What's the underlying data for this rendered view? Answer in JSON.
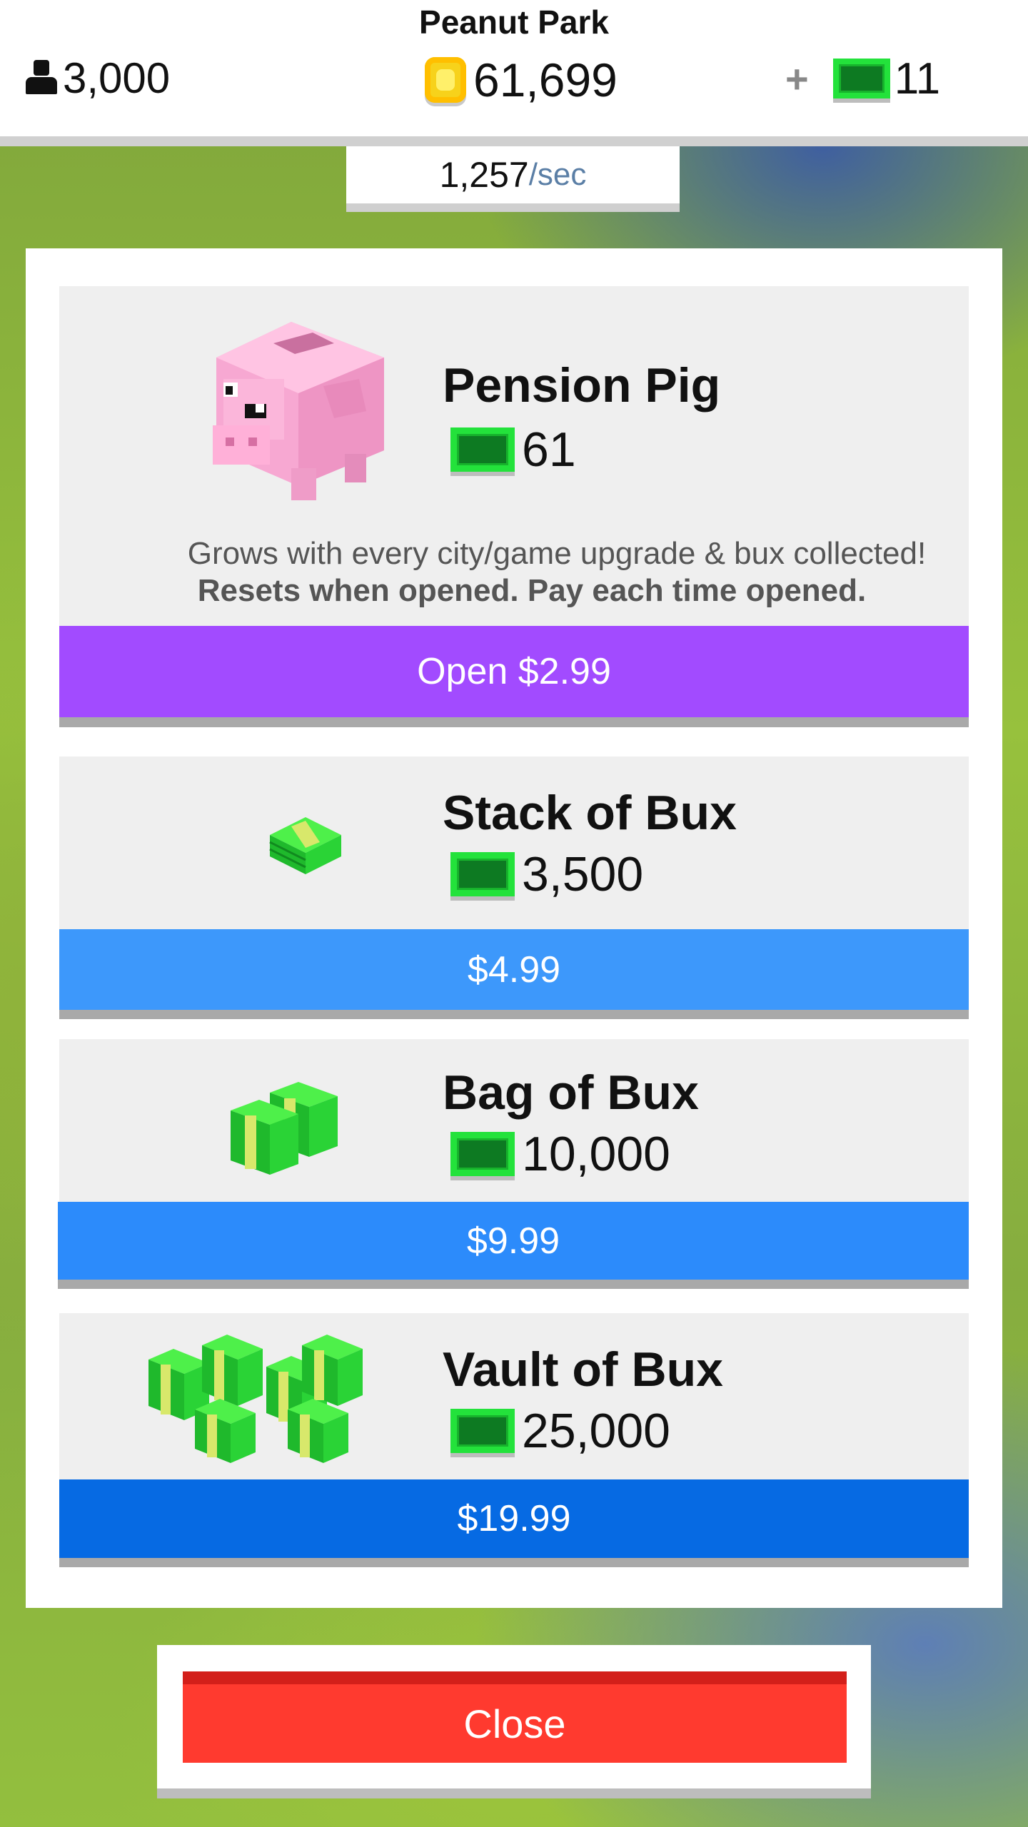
{
  "top_bar": {
    "city_name": "Peanut Park",
    "population": "3,000",
    "coins": "61,699",
    "plus_label": "+",
    "bux": "11",
    "rate_value": "1,257",
    "rate_unit": "/sec"
  },
  "shop": {
    "pension_pig": {
      "title": "Pension Pig",
      "amount": "61",
      "description": "Grows with every city/game upgrade & bux collected!",
      "note": "Resets when opened. Pay each time opened.",
      "button_label": "Open $2.99",
      "button_color": "#a24bff"
    },
    "stack": {
      "title": "Stack of Bux",
      "amount": "3,500",
      "button_label": "$4.99",
      "button_color": "#3d98fb"
    },
    "bag": {
      "title": "Bag of Bux",
      "amount": "10,000",
      "button_label": "$9.99",
      "button_color": "#2c8bfb"
    },
    "vault": {
      "title": "Vault of Bux",
      "amount": "25,000",
      "button_label": "$19.99",
      "button_color": "#066ae3"
    }
  },
  "close_label": "Close",
  "icons": {
    "population": "person-icon",
    "coins": "coin-icon",
    "bux": "cash-icon",
    "pig": "piggy-bank-icon"
  },
  "colors": {
    "close_button": "#ff3a2f",
    "cash_green": "#23e23b"
  }
}
